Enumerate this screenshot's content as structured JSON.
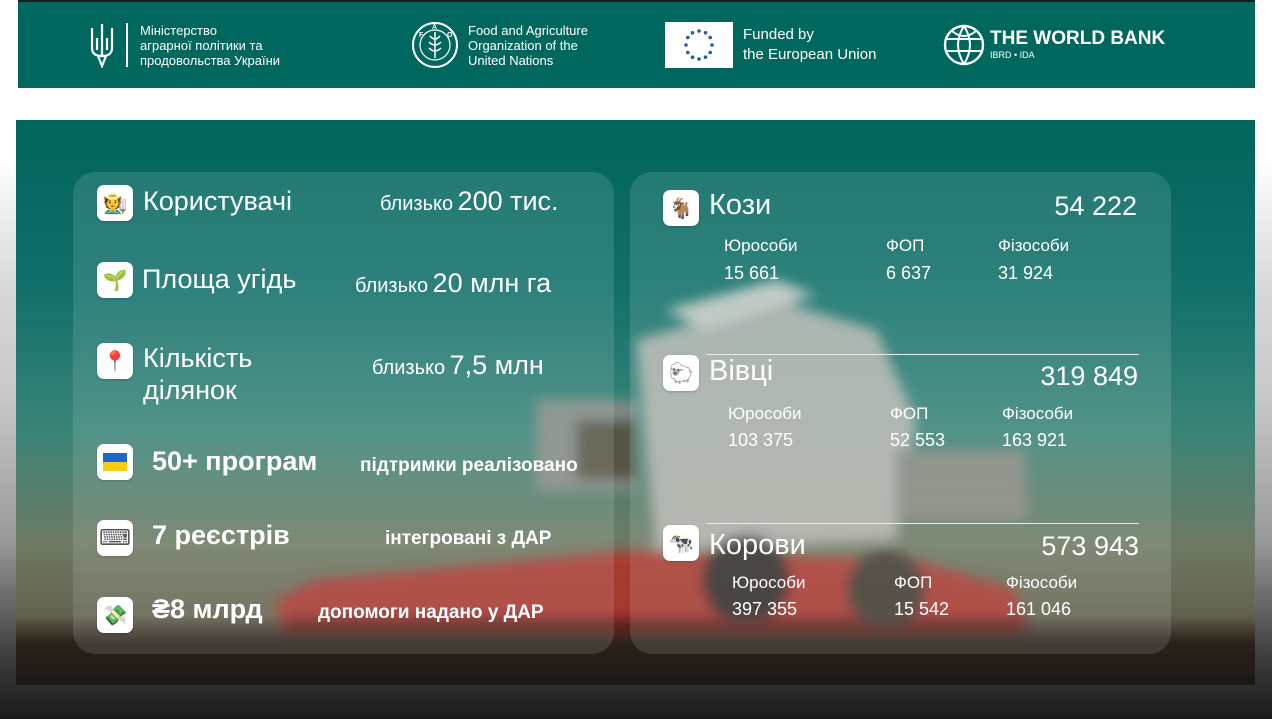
{
  "header": {
    "ministry": [
      "Міністерство",
      "аграрної політики та",
      "продовольства України"
    ],
    "fao": [
      "Food and Agriculture",
      "Organization of the",
      "United Nations"
    ],
    "fao_seal": "FAO FIAT PANIS",
    "eu": [
      "Funded by",
      "the European Union"
    ],
    "worldbank_title": "THE WORLD BANK",
    "worldbank_sub": "IBRD • IDA"
  },
  "stats": [
    {
      "icon": "farmer-icon",
      "glyph": "🧑‍🌾",
      "label": "Користувачі",
      "prefix": "близько",
      "value": "200 тис."
    },
    {
      "icon": "seedling-icon",
      "glyph": "🌱",
      "label": "Площа угідь",
      "prefix": "близько",
      "value": "20 млн га"
    },
    {
      "icon": "pin-icon",
      "glyph": "📍",
      "label_line1": "Кількість",
      "label_line2": "ділянок",
      "prefix": "близько",
      "value": "7,5 млн"
    },
    {
      "icon": "ukraine-flag-icon",
      "label": "50+ програм",
      "note": "підтримки реалізовано"
    },
    {
      "icon": "keyboard-icon",
      "glyph": "⌨",
      "label": "7 реєстрів",
      "note": "інтегровані з ДАР"
    },
    {
      "icon": "money-icon",
      "glyph": "💸",
      "label": "₴8 млрд",
      "note": "допомоги надано у ДАР"
    }
  ],
  "livestock": [
    {
      "icon": "goat-icon",
      "glyph": "🐐",
      "name": "Кози",
      "total": "54 222",
      "cols": [
        {
          "label": "Юрособи",
          "value": "15 661"
        },
        {
          "label": "ФОП",
          "value": "6 637"
        },
        {
          "label": "Фізособи",
          "value": "31 924"
        }
      ]
    },
    {
      "icon": "sheep-icon",
      "glyph": "🐑",
      "name": "Вівці",
      "total": "319 849",
      "cols": [
        {
          "label": "Юрособи",
          "value": "103 375"
        },
        {
          "label": "ФОП",
          "value": "52 553"
        },
        {
          "label": "Фізособи",
          "value": "163 921"
        }
      ]
    },
    {
      "icon": "cow-icon",
      "glyph": "🐄",
      "name": "Корови",
      "total": "573 943",
      "cols": [
        {
          "label": "Юрособи",
          "value": "397 355"
        },
        {
          "label": "ФОП",
          "value": "15 542"
        },
        {
          "label": "Фізособи",
          "value": "161 046"
        }
      ]
    }
  ],
  "colors": {
    "teal": "#00675e",
    "white": "#ffffff"
  }
}
